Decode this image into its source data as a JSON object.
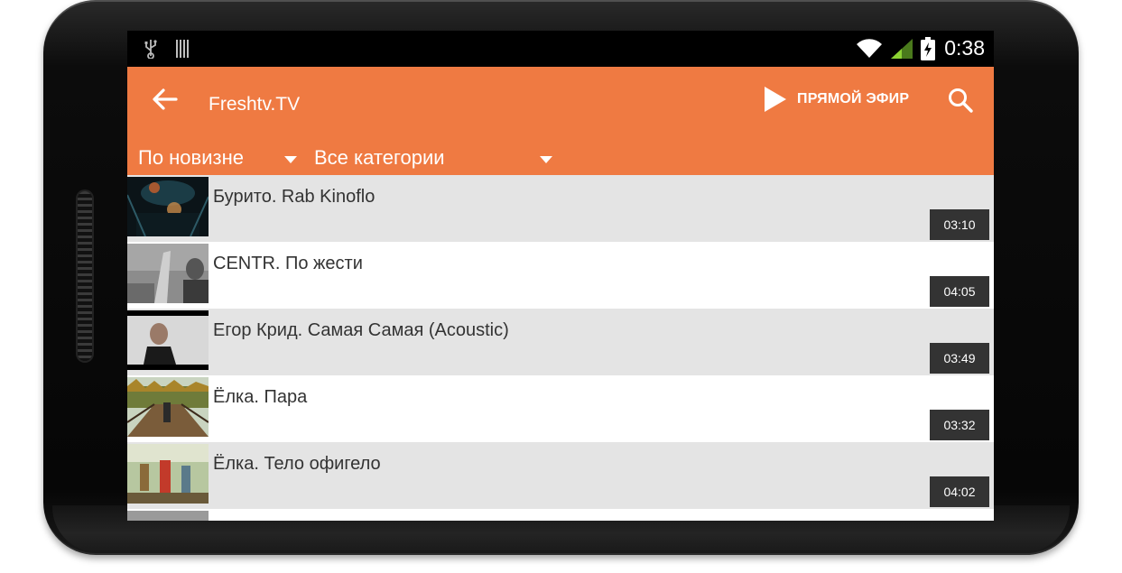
{
  "status_bar": {
    "time": "0:38",
    "icons": [
      "usb-icon",
      "barcode-icon",
      "wifi-icon",
      "cell-signal-icon",
      "battery-charging-icon"
    ]
  },
  "app_bar": {
    "title": "Freshtv.TV",
    "live_label": "ПРЯМОЙ ЭФИР",
    "accent_color": "#ef7a42"
  },
  "filters": {
    "sort_label": "По новизне",
    "category_label": "Все категории"
  },
  "videos": [
    {
      "title": "Бурито. Rab Kinoflo",
      "duration": "03:10"
    },
    {
      "title": "CENTR. По жести",
      "duration": "04:05"
    },
    {
      "title": "Егор Крид. Самая Самая (Acoustic)",
      "duration": "03:49"
    },
    {
      "title": "Ёлка. Пара",
      "duration": "03:32"
    },
    {
      "title": "Ёлка. Тело офигело",
      "duration": "04:02"
    }
  ]
}
